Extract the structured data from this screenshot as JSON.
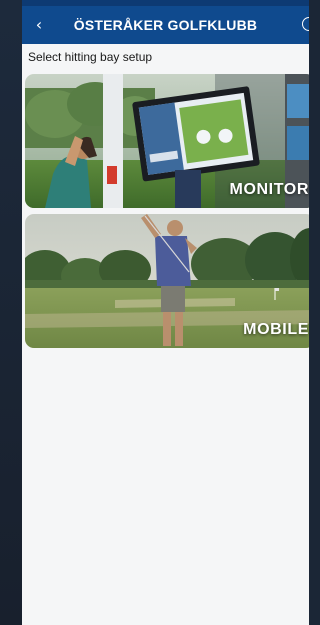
{
  "header": {
    "title": "ÖSTERÅKER GOLFKLUBB",
    "back_icon": "chevron-left-icon",
    "info_icon": "info-circle-icon"
  },
  "subtitle": "Select hitting bay setup",
  "options": [
    {
      "label": "MONITOR",
      "image": "golfer-with-monitor-photo"
    },
    {
      "label": "MOBILE",
      "image": "golfer-on-driving-range-photo"
    }
  ],
  "colors": {
    "header_bg": "#0f4a8e",
    "statusbar_bg": "#0d3a73",
    "page_bg": "#f5f6f7",
    "gutter_bg": "#1b2636"
  }
}
